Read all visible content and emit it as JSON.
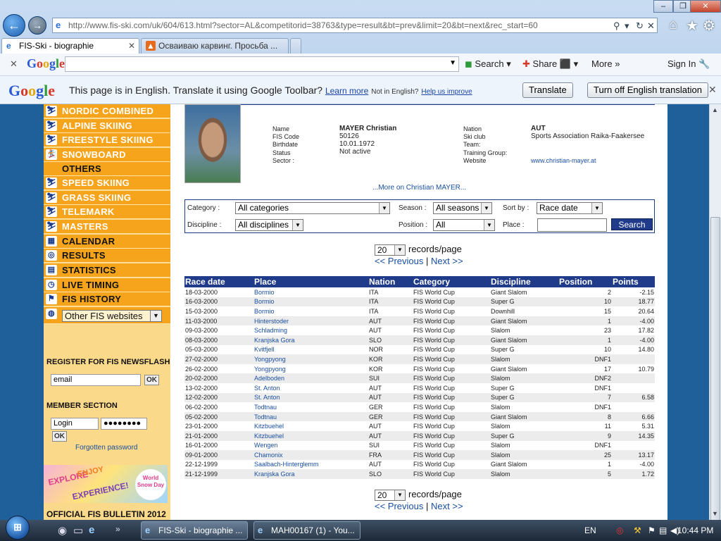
{
  "browser": {
    "url": "http://www.fis-ski.com/uk/604/613.html?sector=AL&competitorid=38763&type=result&bt=prev&limit=20&bt=next&rec_start=60",
    "tabs": [
      {
        "label": "FIS-Ski - biographie",
        "active": true
      },
      {
        "label": "Осваиваю карвинг. Просьба ...",
        "active": false
      }
    ]
  },
  "googlebar": {
    "logo": "Google",
    "search_label": "Search",
    "share_label": "Share",
    "more_label": "More »",
    "signin_label": "Sign In"
  },
  "translatebar": {
    "message": "This page is in English.  Translate it using Google Toolbar?",
    "learn_more": "Learn more",
    "not_english": "Not in English?",
    "help_improve": "Help us improve",
    "translate_btn": "Translate",
    "turn_off_btn": "Turn off English translation"
  },
  "sidebar": {
    "menu": [
      {
        "label": "NORDIC COMBINED",
        "icon": "nordic-combined-icon"
      },
      {
        "label": "ALPINE SKIING",
        "icon": "alpine-skiing-icon"
      },
      {
        "label": "FREESTYLE SKIING",
        "icon": "freestyle-icon"
      },
      {
        "label": "SNOWBOARD",
        "icon": "snowboard-icon"
      },
      {
        "label": "OTHERS",
        "icon": ""
      },
      {
        "label": "SPEED SKIING",
        "icon": "speed-skiing-icon"
      },
      {
        "label": "GRASS SKIING",
        "icon": "grass-skiing-icon"
      },
      {
        "label": "TELEMARK",
        "icon": "telemark-icon"
      },
      {
        "label": "MASTERS",
        "icon": "masters-icon"
      },
      {
        "label": "CALENDAR",
        "icon": "calendar-icon"
      },
      {
        "label": "RESULTS",
        "icon": "results-icon"
      },
      {
        "label": "STATISTICS",
        "icon": "statistics-icon"
      },
      {
        "label": "LIVE TIMING",
        "icon": "clock-icon"
      },
      {
        "label": "FIS HISTORY",
        "icon": "history-icon"
      }
    ],
    "other_sites": "Other FIS websites",
    "newsflash_title": "REGISTER FOR FIS NEWSFLASH",
    "email_value": "email",
    "ok_label": "OK",
    "member_title": "MEMBER SECTION",
    "login_value": "Login",
    "password_value": "●●●●●●●●",
    "forgotten": "Forgotten password",
    "banner": {
      "explore": "EXPLORE",
      "enjoy": "ENJOY",
      "experience": "EXPERIENCE!",
      "worldsnowday": "World Snow Day"
    },
    "bulletin": "OFFICIAL FIS BULLETIN 2012"
  },
  "athlete": {
    "labels": {
      "name": "Name",
      "fiscode": "FIS Code",
      "birthdate": "Birthdate",
      "status": "Status",
      "sector": "Sector :",
      "nation": "Nation",
      "skiclub": "Ski club",
      "team": "Team:",
      "training": "Training Group:",
      "website": "Website"
    },
    "name": "MAYER Christian",
    "fiscode": "50126",
    "birthdate": "10.01.1972",
    "status": "Not active",
    "nation": "AUT",
    "skiclub": "Sports Association Raika-Faakersee",
    "website": "www.christian-mayer.at",
    "more_link": "...More on Christian MAYER..."
  },
  "filters": {
    "category_label": "Category :",
    "category_value": "All categories",
    "season_label": "Season :",
    "season_value": "All seasons",
    "sortby_label": "Sort by :",
    "sortby_value": "Race date",
    "discipline_label": "Discipline :",
    "discipline_value": "All disciplines",
    "position_label": "Position :",
    "position_value": "All",
    "place_label": "Place :",
    "place_value": "",
    "search_label": "Search"
  },
  "pager": {
    "per_page": "20",
    "records_label": "records/page",
    "previous": "<< Previous",
    "separator": "|",
    "next": "Next >>"
  },
  "table": {
    "headers": [
      "Race date",
      "Place",
      "Nation",
      "Category",
      "Discipline",
      "Position",
      "Points"
    ],
    "rows": [
      [
        "18-03-2000",
        "Bormio",
        "ITA",
        "FIS World Cup",
        "Giant Slalom",
        "2",
        "-2.15"
      ],
      [
        "16-03-2000",
        "Bormio",
        "ITA",
        "FIS World Cup",
        "Super G",
        "10",
        "18.77"
      ],
      [
        "15-03-2000",
        "Bormio",
        "ITA",
        "FIS World Cup",
        "Downhill",
        "15",
        "20.64"
      ],
      [
        "11-03-2000",
        "Hinterstoder",
        "AUT",
        "FIS World Cup",
        "Giant Slalom",
        "1",
        "-4.00"
      ],
      [
        "09-03-2000",
        "Schladming",
        "AUT",
        "FIS World Cup",
        "Slalom",
        "23",
        "17.82"
      ],
      [
        "08-03-2000",
        "Kranjska Gora",
        "SLO",
        "FIS World Cup",
        "Giant Slalom",
        "1",
        "-4.00"
      ],
      [
        "05-03-2000",
        "Kvitfjell",
        "NOR",
        "FIS World Cup",
        "Super G",
        "10",
        "14.80"
      ],
      [
        "27-02-2000",
        "Yongpyong",
        "KOR",
        "FIS World Cup",
        "Slalom",
        "DNF1",
        ""
      ],
      [
        "26-02-2000",
        "Yongpyong",
        "KOR",
        "FIS World Cup",
        "Giant Slalom",
        "17",
        "10.79"
      ],
      [
        "20-02-2000",
        "Adelboden",
        "SUI",
        "FIS World Cup",
        "Slalom",
        "DNF2",
        ""
      ],
      [
        "13-02-2000",
        "St. Anton",
        "AUT",
        "FIS World Cup",
        "Super G",
        "DNF1",
        ""
      ],
      [
        "12-02-2000",
        "St. Anton",
        "AUT",
        "FIS World Cup",
        "Super G",
        "7",
        "6.58"
      ],
      [
        "06-02-2000",
        "Todtnau",
        "GER",
        "FIS World Cup",
        "Slalom",
        "DNF1",
        ""
      ],
      [
        "05-02-2000",
        "Todtnau",
        "GER",
        "FIS World Cup",
        "Giant Slalom",
        "8",
        "6.66"
      ],
      [
        "23-01-2000",
        "Kitzbuehel",
        "AUT",
        "FIS World Cup",
        "Slalom",
        "11",
        "5.31"
      ],
      [
        "21-01-2000",
        "Kitzbuehel",
        "AUT",
        "FIS World Cup",
        "Super G",
        "9",
        "14.35"
      ],
      [
        "16-01-2000",
        "Wengen",
        "SUI",
        "FIS World Cup",
        "Slalom",
        "DNF1",
        ""
      ],
      [
        "09-01-2000",
        "Chamonix",
        "FRA",
        "FIS World Cup",
        "Slalom",
        "25",
        "13.17"
      ],
      [
        "22-12-1999",
        "Saalbach-Hinterglemm",
        "AUT",
        "FIS World Cup",
        "Giant Slalom",
        "1",
        "-4.00"
      ],
      [
        "21-12-1999",
        "Kranjska Gora",
        "SLO",
        "FIS World Cup",
        "Slalom",
        "5",
        "1.72"
      ]
    ]
  },
  "taskbar": {
    "tasks": [
      "FIS-Ski - biographie ...",
      "MAH00167 (1) - You..."
    ],
    "language": "EN",
    "time": "10:44 PM"
  }
}
